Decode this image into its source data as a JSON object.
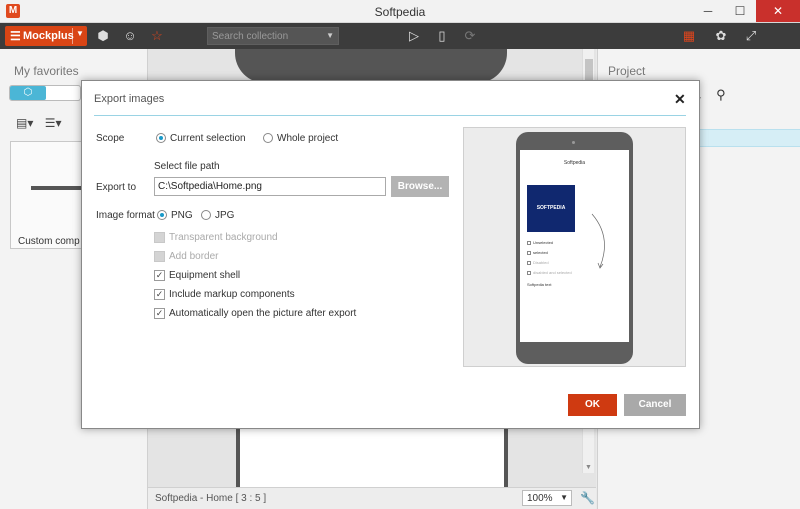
{
  "window": {
    "title": "Softpedia",
    "minimize": "─",
    "maximize": "☐",
    "close": "✕"
  },
  "toolbar": {
    "brand": "Mockplus",
    "search_placeholder": "Search collection",
    "icons": [
      "menu-icon",
      "cube-icon",
      "emoji-icon",
      "star-icon",
      "play-icon",
      "phone-icon",
      "rotate-icon",
      "grid-icon",
      "palette-icon",
      "fullscreen-icon"
    ]
  },
  "left_panel": {
    "title": "My favorites",
    "card_caption": "Custom compon"
  },
  "right_panel": {
    "title": "Project"
  },
  "status": {
    "text": "Softpedia - Home [ 3 : 5 ]",
    "zoom": "100%"
  },
  "dialog": {
    "title": "Export images",
    "scope_label": "Scope",
    "scope_current": "Current selection",
    "scope_project": "Whole project",
    "path_hint": "Select file path",
    "export_to_label": "Export to",
    "path_value": "C:\\Softpedia\\Home.png",
    "browse": "Browse...",
    "format_label": "Image format",
    "format_png": "PNG",
    "format_jpg": "JPG",
    "options": [
      {
        "label": "Transparent background",
        "checked": false,
        "enabled": false
      },
      {
        "label": "Add border",
        "checked": false,
        "enabled": false
      },
      {
        "label": "Equipment shell",
        "checked": true,
        "enabled": true
      },
      {
        "label": "Include markup components",
        "checked": true,
        "enabled": true
      },
      {
        "label": "Automatically open the picture after export",
        "checked": true,
        "enabled": true
      }
    ],
    "ok": "OK",
    "cancel": "Cancel",
    "preview": {
      "title": "Softpedia",
      "logo_text": "SOFTPEDIA",
      "items": [
        "Unselected",
        "selected",
        "Disabled",
        "disabled and selected"
      ],
      "footer_text": "Softpedia text"
    }
  },
  "accent_colors": {
    "brand": "#d94515",
    "ok": "#cf3a11",
    "highlight": "#1a9ac9"
  }
}
